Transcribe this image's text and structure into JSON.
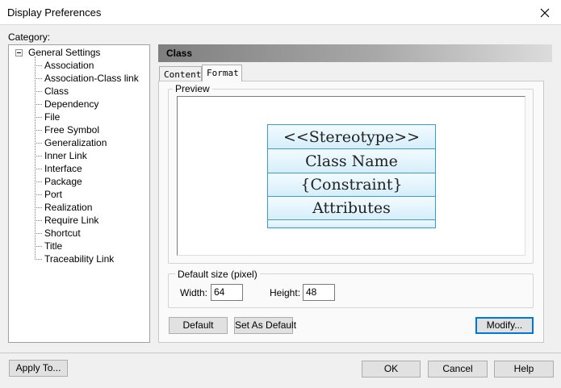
{
  "window": {
    "title": "Display Preferences"
  },
  "category": {
    "label": "Category:",
    "root": "General Settings",
    "items": [
      "Association",
      "Association-Class link",
      "Class",
      "Dependency",
      "File",
      "Free Symbol",
      "Generalization",
      "Inner Link",
      "Interface",
      "Package",
      "Port",
      "Realization",
      "Require Link",
      "Shortcut",
      "Title",
      "Traceability Link"
    ]
  },
  "section_title": "Class",
  "tabs": [
    {
      "label": "Content",
      "active": false
    },
    {
      "label": "Format",
      "active": true
    }
  ],
  "preview": {
    "group_label": "Preview",
    "rows": [
      "<<Stereotype>>",
      "Class Name",
      "{Constraint}",
      "Attributes"
    ]
  },
  "default_size": {
    "group_label": "Default size (pixel)",
    "width_label": "Width:",
    "width_value": "64",
    "height_label": "Height:",
    "height_value": "48"
  },
  "buttons": {
    "default": "Default",
    "set_as_default": "Set As Default",
    "modify": "Modify...",
    "apply_to": "Apply To...",
    "ok": "OK",
    "cancel": "Cancel",
    "help": "Help"
  },
  "colors": {
    "uml_border": "#3b9ad4",
    "uml_fill": "#dff1fb",
    "focus": "#0078d7"
  }
}
